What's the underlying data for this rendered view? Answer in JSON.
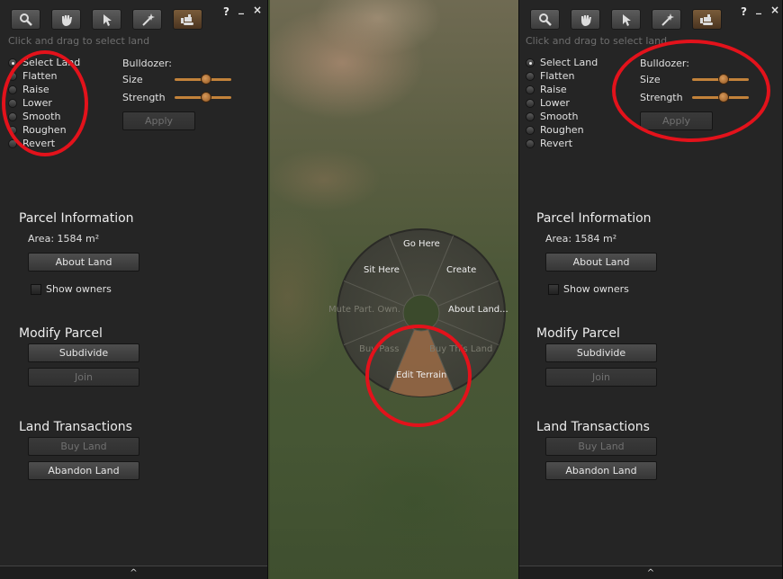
{
  "toolbar": {
    "tools": [
      {
        "icon": "zoom-icon"
      },
      {
        "icon": "grab-icon"
      },
      {
        "icon": "pointer-icon"
      },
      {
        "icon": "magic-wand-icon"
      },
      {
        "icon": "bulldozer-icon",
        "selected": true
      }
    ],
    "help_label": "?",
    "minimize_label": "_",
    "close_label": "×"
  },
  "hint": "Click and drag to select land",
  "radio_options": [
    "Select Land",
    "Flatten",
    "Raise",
    "Lower",
    "Smooth",
    "Roughen",
    "Revert"
  ],
  "selected_option": "Select Land",
  "bulldozer": {
    "title": "Bulldozer:",
    "size_label": "Size",
    "strength_label": "Strength",
    "size_value": 0.5,
    "strength_value": 0.5,
    "apply_label": "Apply"
  },
  "parcel": {
    "title": "Parcel Information",
    "area": "Area: 1584 m²",
    "about_land": "About Land",
    "show_owners": "Show owners"
  },
  "modify": {
    "title": "Modify Parcel",
    "subdivide": "Subdivide",
    "join": "Join"
  },
  "transactions": {
    "title": "Land Transactions",
    "buy_land": "Buy Land",
    "abandon_land": "Abandon Land"
  },
  "pie_menu": {
    "go_here": "Go Here",
    "create": "Create",
    "about_land": "About Land...",
    "buy_this_land": "Buy This Land",
    "edit_terrain": "Edit Terrain",
    "buy_pass": "Buy Pass",
    "mute_part_own": "Mute Part. Own.",
    "sit_here": "Sit Here"
  },
  "bottom_arrow": "^",
  "colors": {
    "panel_bg": "#252525",
    "accent_orange": "#c2823a",
    "annotation_red": "#e3121b"
  }
}
